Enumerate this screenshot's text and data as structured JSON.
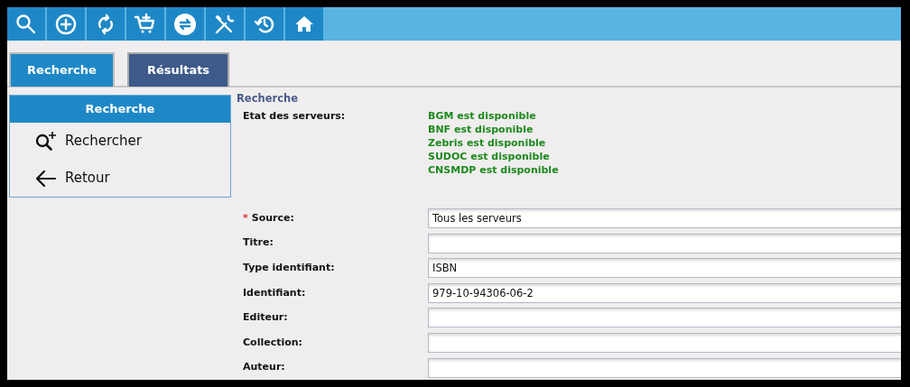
{
  "toolbar": {
    "buttons": [
      {
        "kind": "search"
      },
      {
        "kind": "add"
      },
      {
        "kind": "refresh"
      },
      {
        "kind": "cart"
      },
      {
        "kind": "exchange"
      },
      {
        "kind": "tools"
      },
      {
        "kind": "history"
      },
      {
        "kind": "home"
      }
    ]
  },
  "tabs": [
    {
      "label": "Recherche",
      "selected": true
    },
    {
      "label": "Résultats",
      "selected": false
    }
  ],
  "side_panel": {
    "title": "Recherche",
    "items": [
      {
        "label": "Rechercher",
        "kind": "search"
      },
      {
        "label": "Retour",
        "kind": "back"
      }
    ]
  },
  "form": {
    "legend": "Recherche",
    "status_label": "Etat des serveurs:",
    "servers": [
      "BGM est disponible",
      "BNF est disponible",
      "Zebris est disponible",
      "SUDOC est disponible",
      "CNSMDP est disponible"
    ],
    "fields": [
      {
        "label": "Source:",
        "marker": "*",
        "value": "Tous les serveurs"
      },
      {
        "label": "Titre:"
      },
      {
        "label": "Type identifiant:",
        "value": "ISBN"
      },
      {
        "label": "Identifiant:",
        "value": "979-10-94306-06-2"
      },
      {
        "label": "Editeur:"
      },
      {
        "label": "Collection:"
      },
      {
        "label": "Auteur:"
      }
    ]
  }
}
